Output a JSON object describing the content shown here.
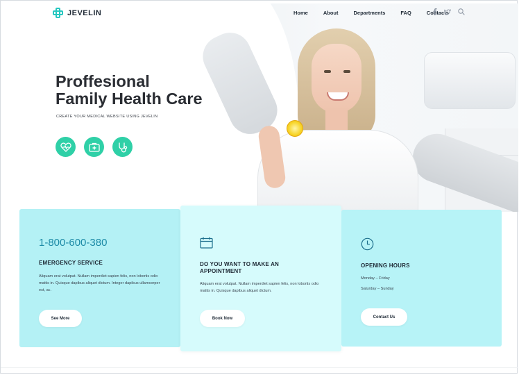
{
  "brand": {
    "name": "JEVELIN",
    "accent": "#27c7c0"
  },
  "nav": {
    "items": [
      "Home",
      "About",
      "Departments",
      "FAQ",
      "Contacts"
    ],
    "icons": [
      "facebook-icon",
      "twitter-icon",
      "search-icon"
    ]
  },
  "hero": {
    "title_line1": "Proffesional",
    "title_line2": "Family Health Care",
    "subtitle": "CREATE YOUR MEDICAL WEBSITE USING JEVELIN",
    "icons": [
      "heart-pulse-icon",
      "medical-kit-icon",
      "stethoscope-icon"
    ],
    "icon_color": "#2fd0a7"
  },
  "cards": {
    "emergency": {
      "phone": "1-800-600-380",
      "title": "EMERGENCY SERVICE",
      "text": "Aliquam erat volutpat. Nullam imperdiet sapien felis, non lobortis odio mattis in. Quisque dapibus aliquet dictum. Integer dapibus ullamcorper est, ac.",
      "button": "See More"
    },
    "appointment": {
      "icon": "calendar-icon",
      "title": "DO YOU WANT TO MAKE AN APPOINTMENT",
      "text": "Aliquam erat volutpat. Nullam imperdiet sapien felis, non lobortis odio mattis in. Quisque dapibus aliquet dictum.",
      "button": "Book Now"
    },
    "hours": {
      "icon": "clock-icon",
      "title": "OPENING HOURS",
      "line1": "Monday – Friday",
      "line2": "Saturday – Sunday",
      "button": "Contact Us"
    }
  }
}
